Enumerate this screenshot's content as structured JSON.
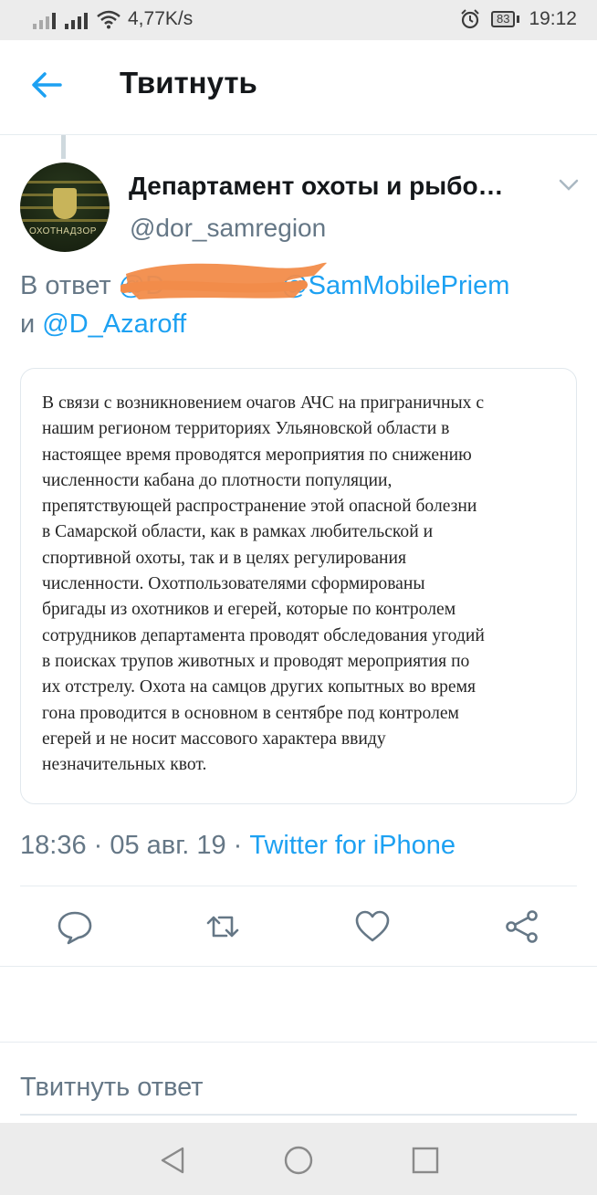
{
  "status_bar": {
    "network_speed": "4,77K/s",
    "battery": "83",
    "time": "19:12"
  },
  "header": {
    "title": "Твитнуть"
  },
  "tweet": {
    "display_name": "Департамент охоты и рыбо…",
    "handle": "@dor_samregion",
    "avatar_text": "ОХОТНАДЗОР",
    "reply_prefix": "В ответ",
    "reply_mention_hidden": "@D",
    "reply_mention_1": "@SamMobilePriem",
    "reply_and": "и",
    "reply_mention_2": "@D_Azaroff",
    "image_text_lines": [
      "В связи  с возникновением очагов АЧС на приграничных с",
      "нашим регионом территориях Ульяновской области в",
      "настоящее время проводятся мероприятия по снижению",
      "численности кабана до плотности популяции,",
      "препятствующей распространение этой опасной болезни",
      "в Самарской области, как в рамках любительской и",
      "спортивной охоты, так и в целях регулирования",
      "численности. Охотпользователями сформированы",
      "бригады из охотников и егерей, которые по контролем",
      "сотрудников департамента проводят обследования угодий",
      "в поисках трупов животных и проводят мероприятия по",
      "их отстрелу. Охота на самцов других копытных во время",
      "гона проводится в основном в сентябре под контролем",
      "егерей и не носит массового характера ввиду",
      "незначительных квот."
    ],
    "timestamp": "18:36 · 05 авг. 19 · ",
    "source": "Twitter for iPhone"
  },
  "actions": {
    "reply": "reply-icon",
    "retweet": "retweet-icon",
    "like": "heart-icon",
    "share": "share-icon"
  },
  "reply_box": {
    "placeholder": "Твитнуть ответ"
  },
  "colors": {
    "accent": "#1da1f2",
    "secondary_text": "#657786",
    "redaction": "#f28c4a"
  }
}
